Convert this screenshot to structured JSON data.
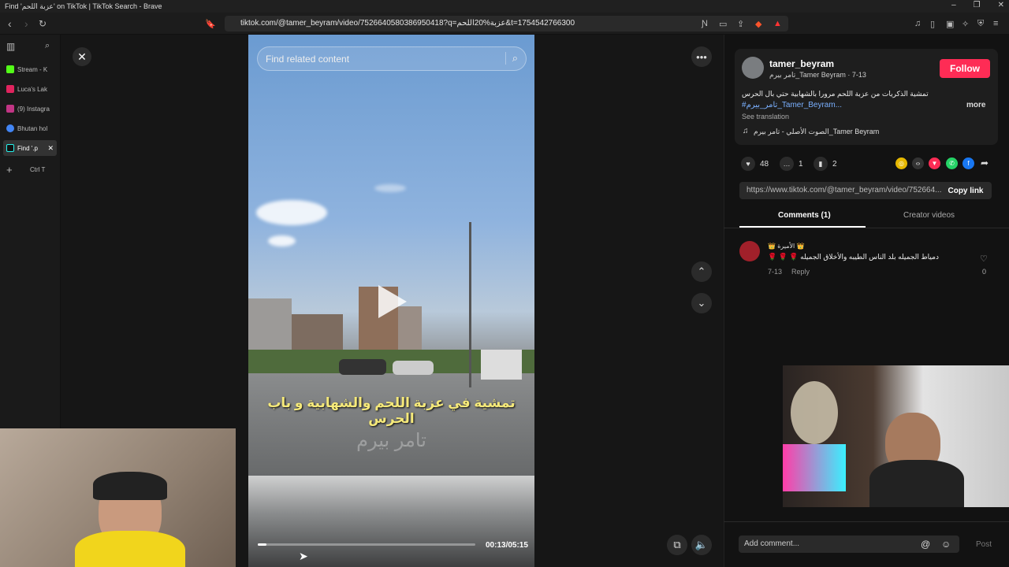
{
  "window": {
    "title": "Find 'عزبة اللحم' on TikTok | TikTok Search - Brave"
  },
  "browser": {
    "url": "tiktok.com/@tamer_beyram/video/7526640580386950418?q=عزبة%20اللحم&t=1754542766300"
  },
  "sidebar": {
    "tabs": [
      {
        "label": "Stream - K",
        "color": "#53fc18"
      },
      {
        "label": "Luca's Lak",
        "color": "#e0245e"
      },
      {
        "label": "(9) Instagra",
        "color": "#c13584"
      },
      {
        "label": "Bhutan hol",
        "color": "#4285f4"
      },
      {
        "label": "Find '.p",
        "color": "#111111"
      }
    ],
    "new_tab_hint": "Ctrl T"
  },
  "video": {
    "search_placeholder": "Find related content",
    "caption": "تمشية في عزبة اللحم والشهابية و باب الحرس",
    "watermark": "تامر بيرم",
    "time": "00:13/05:15",
    "progress": 0.04
  },
  "author": {
    "username": "tamer_beyram",
    "subtitle": "تامر بيرم_Tamer Beyram · 7-13",
    "follow_label": "Follow"
  },
  "post": {
    "description": "تمشية الذكريات من عزبة اللحم مرورا بالشهابية حتي بال الحرس",
    "hashtags": "#تامر_بيرم_Tamer_Beyram...",
    "more_label": "more",
    "see_translation": "See translation",
    "sound": "الصوت الأصلي - تامر بيرم_Tamer Beyram"
  },
  "stats": {
    "likes": "48",
    "comments": "1",
    "saves": "2"
  },
  "link": {
    "url": "https://www.tiktok.com/@tamer_beyram/video/752664...",
    "copy_label": "Copy link"
  },
  "tabs": {
    "comments": "Comments (1)",
    "creator_videos": "Creator videos"
  },
  "comment": {
    "user": "👑 الأميرة 👑",
    "text": "🌹 🌹 🌹 دمياط الجميله بلد الناس الطيبه والأخلاق الجميله",
    "date": "7-13",
    "reply": "Reply",
    "likes": "0"
  },
  "composer": {
    "placeholder": "Add comment...",
    "post_label": "Post"
  },
  "colors": {
    "follow": "#fe2c55",
    "accent_link": "#7ab0ff"
  }
}
